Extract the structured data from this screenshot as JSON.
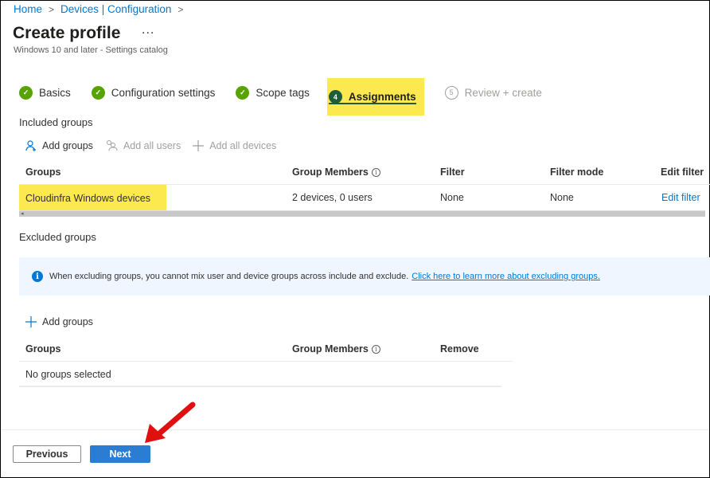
{
  "breadcrumb": [
    {
      "label": "Home"
    },
    {
      "label": "Devices | Configuration"
    }
  ],
  "header": {
    "title": "Create profile",
    "more_label": "...",
    "subtitle": "Windows 10 and later - Settings catalog"
  },
  "steps": [
    {
      "label": "Basics",
      "state": "done",
      "marker": "✓"
    },
    {
      "label": "Configuration settings",
      "state": "done",
      "marker": "✓"
    },
    {
      "label": "Scope tags",
      "state": "done",
      "marker": "✓"
    },
    {
      "label": "Assignments",
      "state": "current",
      "marker": "4"
    },
    {
      "label": "Review + create",
      "state": "todo",
      "marker": "5"
    }
  ],
  "included": {
    "label": "Included groups",
    "toolbar": {
      "add_groups": "Add groups",
      "add_all_users": "Add all users",
      "add_all_devices": "Add all devices"
    },
    "columns": [
      "Groups",
      "Group Members",
      "Filter",
      "Filter mode",
      "Edit filter"
    ],
    "rows": [
      {
        "group": "Cloudinfra Windows devices",
        "members": "2 devices, 0 users",
        "filter": "None",
        "filter_mode": "None",
        "edit_filter": "Edit filter"
      }
    ]
  },
  "excluded": {
    "label": "Excluded groups",
    "info_text": "When excluding groups, you cannot mix user and device groups across include and exclude.",
    "info_link": "Click here to learn more about excluding groups.",
    "add_groups": "Add groups",
    "columns": [
      "Groups",
      "Group Members",
      "Remove"
    ],
    "empty_text": "No groups selected"
  },
  "footer": {
    "previous_label": "Previous",
    "next_label": "Next"
  },
  "colors": {
    "accent": "#0078d4",
    "step_done": "#57a300",
    "step_active": "#1e5c3a",
    "highlight": "#fce94f",
    "primary_button": "#2b7cd3",
    "annotation_arrow": "#e01010"
  }
}
